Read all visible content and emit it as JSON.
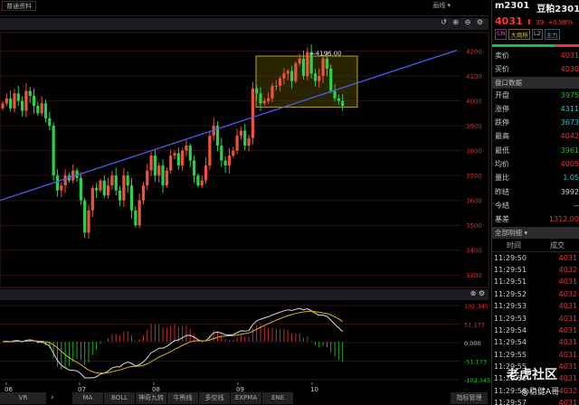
{
  "toolbar": {
    "tag_label": "普通资料",
    "draw_label": "画线 ▾",
    "icons": "↺ ⊕ ⊖ ⚙"
  },
  "quote": {
    "code": "m2301",
    "name": "豆粕2301",
    "price": "4031",
    "change": "39",
    "pct": "+0.98%",
    "badges": [
      "CN",
      "大商所",
      "L2",
      "主力"
    ]
  },
  "book": [
    {
      "label": "卖价",
      "value": "4031",
      "color": "#e33"
    },
    {
      "label": "买价",
      "value": "4030",
      "color": "#e33"
    }
  ],
  "section_title": "盘口数据",
  "stats": [
    {
      "label": "开盘",
      "value": "3975",
      "color": "#2b2"
    },
    {
      "label": "涨停",
      "value": "4311",
      "color": "#3bc"
    },
    {
      "label": "跌停",
      "value": "3673",
      "color": "#3bc"
    },
    {
      "label": "最高",
      "value": "4042",
      "color": "#e33"
    },
    {
      "label": "最低",
      "value": "3961",
      "color": "#2b2"
    },
    {
      "label": "均价",
      "value": "4005",
      "color": "#e33"
    },
    {
      "label": "量比",
      "value": "1.05",
      "color": "#3bc"
    },
    {
      "label": "昨结",
      "value": "3992",
      "color": "#ccc"
    },
    {
      "label": "今结",
      "value": "--",
      "color": "#ccc"
    },
    {
      "label": "基差",
      "value": "1312.00",
      "color": "#e33"
    }
  ],
  "ticks_section": "全部明细 ▾",
  "ticks_header": {
    "time": "时间",
    "price": "成交"
  },
  "ticks": [
    [
      "11:29:50",
      "4031"
    ],
    [
      "11:29:51",
      "4032"
    ],
    [
      "11:29:51",
      "4031"
    ],
    [
      "11:29:52",
      "4032"
    ],
    [
      "11:29:53",
      "4031"
    ],
    [
      "11:29:53",
      "4031"
    ],
    [
      "11:29:54",
      "4031"
    ],
    [
      "11:29:54",
      "4031"
    ],
    [
      "11:29:55",
      "4031"
    ],
    [
      "11:29:55",
      "4031"
    ],
    [
      "11:29:56",
      "4031"
    ],
    [
      "11:29:56",
      "4032"
    ],
    [
      "11:29:57",
      "4031"
    ]
  ],
  "watermark": {
    "brand": "老虎社区",
    "user": "@稳健A哥"
  },
  "annotation": "←4196.00",
  "bottom": {
    "left": [
      "VR"
    ],
    "arrow": "›",
    "indicators": [
      "MA",
      "BOLL",
      "神奇九转",
      "牛熊线",
      "多空线",
      "EXPMA",
      "ENE"
    ],
    "manage": "指标管理"
  },
  "chart_data": {
    "type": "candlestick",
    "price_axis": [
      "4200",
      "4100",
      "4000",
      "3900",
      "3800",
      "3700",
      "3600",
      "3500",
      "3400",
      "3300"
    ],
    "ylim": [
      3250,
      4260
    ],
    "months": [
      "06",
      "07",
      "08",
      "09",
      "10"
    ],
    "closes": [
      3990,
      4010,
      3970,
      4030,
      4000,
      3960,
      4040,
      4020,
      3980,
      3950,
      3990,
      3930,
      3900,
      3700,
      3640,
      3660,
      3700,
      3680,
      3720,
      3690,
      3600,
      3470,
      3560,
      3650,
      3640,
      3680,
      3620,
      3660,
      3700,
      3640,
      3600,
      3700,
      3660,
      3560,
      3500,
      3600,
      3660,
      3720,
      3780,
      3700,
      3740,
      3660,
      3720,
      3780,
      3790,
      3740,
      3800,
      3820,
      3760,
      3700,
      3660,
      3680,
      3740,
      3860,
      3900,
      3820,
      3760,
      3740,
      3780,
      3800,
      3860,
      3880,
      3820,
      3850,
      4050,
      4030,
      3990,
      4000,
      4010,
      4060,
      4060,
      4090,
      4110,
      4120,
      4080,
      4150,
      4170,
      4100,
      4196,
      4110,
      4080,
      4100,
      4170,
      4130,
      4040,
      4010,
      4000,
      3980
    ],
    "macd_axis": [
      "102.345",
      "51.173",
      "0.000",
      "-51.173",
      "-102.345"
    ],
    "macd_scale": 102.345,
    "trendline": [
      3600,
      4200
    ],
    "box": [
      3975,
      4180
    ]
  }
}
